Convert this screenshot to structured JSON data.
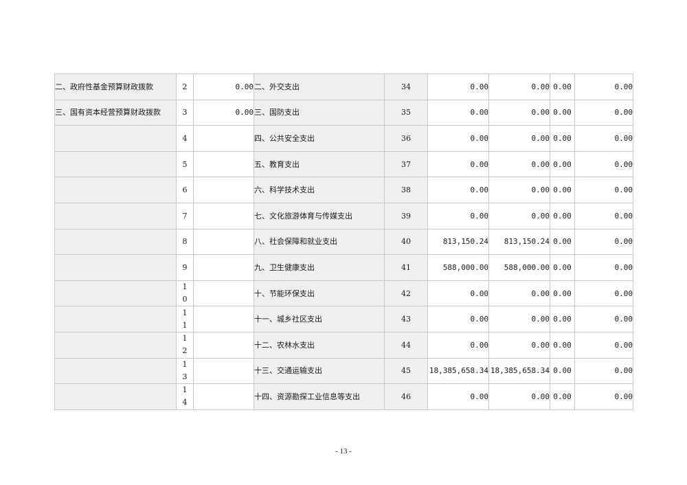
{
  "rows": [
    {
      "income_name": "二、政府性基金预算财政拨款",
      "income_line": "2",
      "income_amount": "0.00",
      "exp_name": "二、外交支出",
      "exp_line": "34",
      "total": "0.00",
      "general": "0.00",
      "fund": "0.00",
      "capital": "0.00"
    },
    {
      "income_name": "三、国有资本经营预算财政拨款",
      "income_line": "3",
      "income_amount": "0.00",
      "exp_name": "三、国防支出",
      "exp_line": "35",
      "total": "0.00",
      "general": "0.00",
      "fund": "0.00",
      "capital": "0.00"
    },
    {
      "income_name": "",
      "income_line": "4",
      "income_amount": "",
      "exp_name": "四、公共安全支出",
      "exp_line": "36",
      "total": "0.00",
      "general": "0.00",
      "fund": "0.00",
      "capital": "0.00"
    },
    {
      "income_name": "",
      "income_line": "5",
      "income_amount": "",
      "exp_name": "五、教育支出",
      "exp_line": "37",
      "total": "0.00",
      "general": "0.00",
      "fund": "0.00",
      "capital": "0.00"
    },
    {
      "income_name": "",
      "income_line": "6",
      "income_amount": "",
      "exp_name": "六、科学技术支出",
      "exp_line": "38",
      "total": "0.00",
      "general": "0.00",
      "fund": "0.00",
      "capital": "0.00"
    },
    {
      "income_name": "",
      "income_line": "7",
      "income_amount": "",
      "exp_name": "七、文化旅游体育与传媒支出",
      "exp_line": "39",
      "total": "0.00",
      "general": "0.00",
      "fund": "0.00",
      "capital": "0.00"
    },
    {
      "income_name": "",
      "income_line": "8",
      "income_amount": "",
      "exp_name": "八、社会保障和就业支出",
      "exp_line": "40",
      "total": "813,150.24",
      "general": "813,150.24",
      "fund": "0.00",
      "capital": "0.00"
    },
    {
      "income_name": "",
      "income_line": "9",
      "income_amount": "",
      "exp_name": "九、卫生健康支出",
      "exp_line": "41",
      "total": "588,000.00",
      "general": "588,000.00",
      "fund": "0.00",
      "capital": "0.00"
    },
    {
      "income_name": "",
      "income_line": "10",
      "income_amount": "",
      "exp_name": "十、节能环保支出",
      "exp_line": "42",
      "total": "0.00",
      "general": "0.00",
      "fund": "0.00",
      "capital": "0.00"
    },
    {
      "income_name": "",
      "income_line": "11",
      "income_amount": "",
      "exp_name": "十一、城乡社区支出",
      "exp_line": "43",
      "total": "0.00",
      "general": "0.00",
      "fund": "0.00",
      "capital": "0.00"
    },
    {
      "income_name": "",
      "income_line": "12",
      "income_amount": "",
      "exp_name": "十二、农林水支出",
      "exp_line": "44",
      "total": "0.00",
      "general": "0.00",
      "fund": "0.00",
      "capital": "0.00"
    },
    {
      "income_name": "",
      "income_line": "13",
      "income_amount": "",
      "exp_name": "十三、交通运输支出",
      "exp_line": "45",
      "total": "18,385,658.34",
      "general": "18,385,658.34",
      "fund": "0.00",
      "capital": "0.00"
    },
    {
      "income_name": "",
      "income_line": "14",
      "income_amount": "",
      "exp_name": "十四、资源勘探工业信息等支出",
      "exp_line": "46",
      "total": "0.00",
      "general": "0.00",
      "fund": "0.00",
      "capital": "0.00"
    }
  ],
  "footer": {
    "page_number": "- 13 -"
  }
}
